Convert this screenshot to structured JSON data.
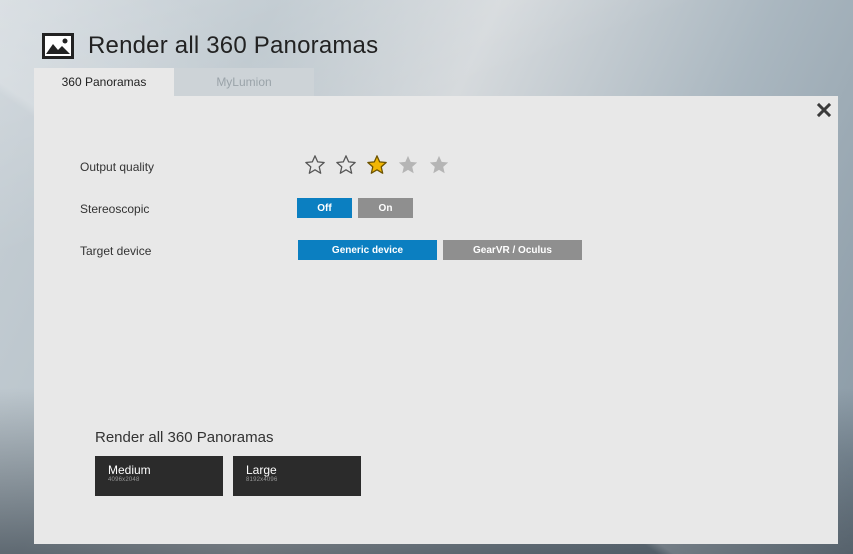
{
  "header": {
    "title": "Render all 360 Panoramas",
    "icon": "panorama-icon"
  },
  "tabs": [
    {
      "label": "360 Panoramas",
      "active": true
    },
    {
      "label": "MyLumion",
      "active": false
    }
  ],
  "settings": {
    "output_quality": {
      "label": "Output quality",
      "rating": 3,
      "max": 5
    },
    "stereoscopic": {
      "label": "Stereoscopic",
      "options": [
        "Off",
        "On"
      ],
      "selected": "Off"
    },
    "target_device": {
      "label": "Target device",
      "options": [
        "Generic device",
        "GearVR / Oculus"
      ],
      "selected": "Generic device"
    }
  },
  "render": {
    "title": "Render all 360 Panoramas",
    "sizes": [
      {
        "label": "Medium",
        "resolution": "4096x2048"
      },
      {
        "label": "Large",
        "resolution": "8192x4096"
      }
    ]
  },
  "colors": {
    "accent_blue": "#0b7fc1",
    "inactive_gray": "#8f8f8f",
    "star_active": "#f2b705",
    "star_inactive": "#b5b5b5",
    "dark_button": "#2b2b2b"
  }
}
